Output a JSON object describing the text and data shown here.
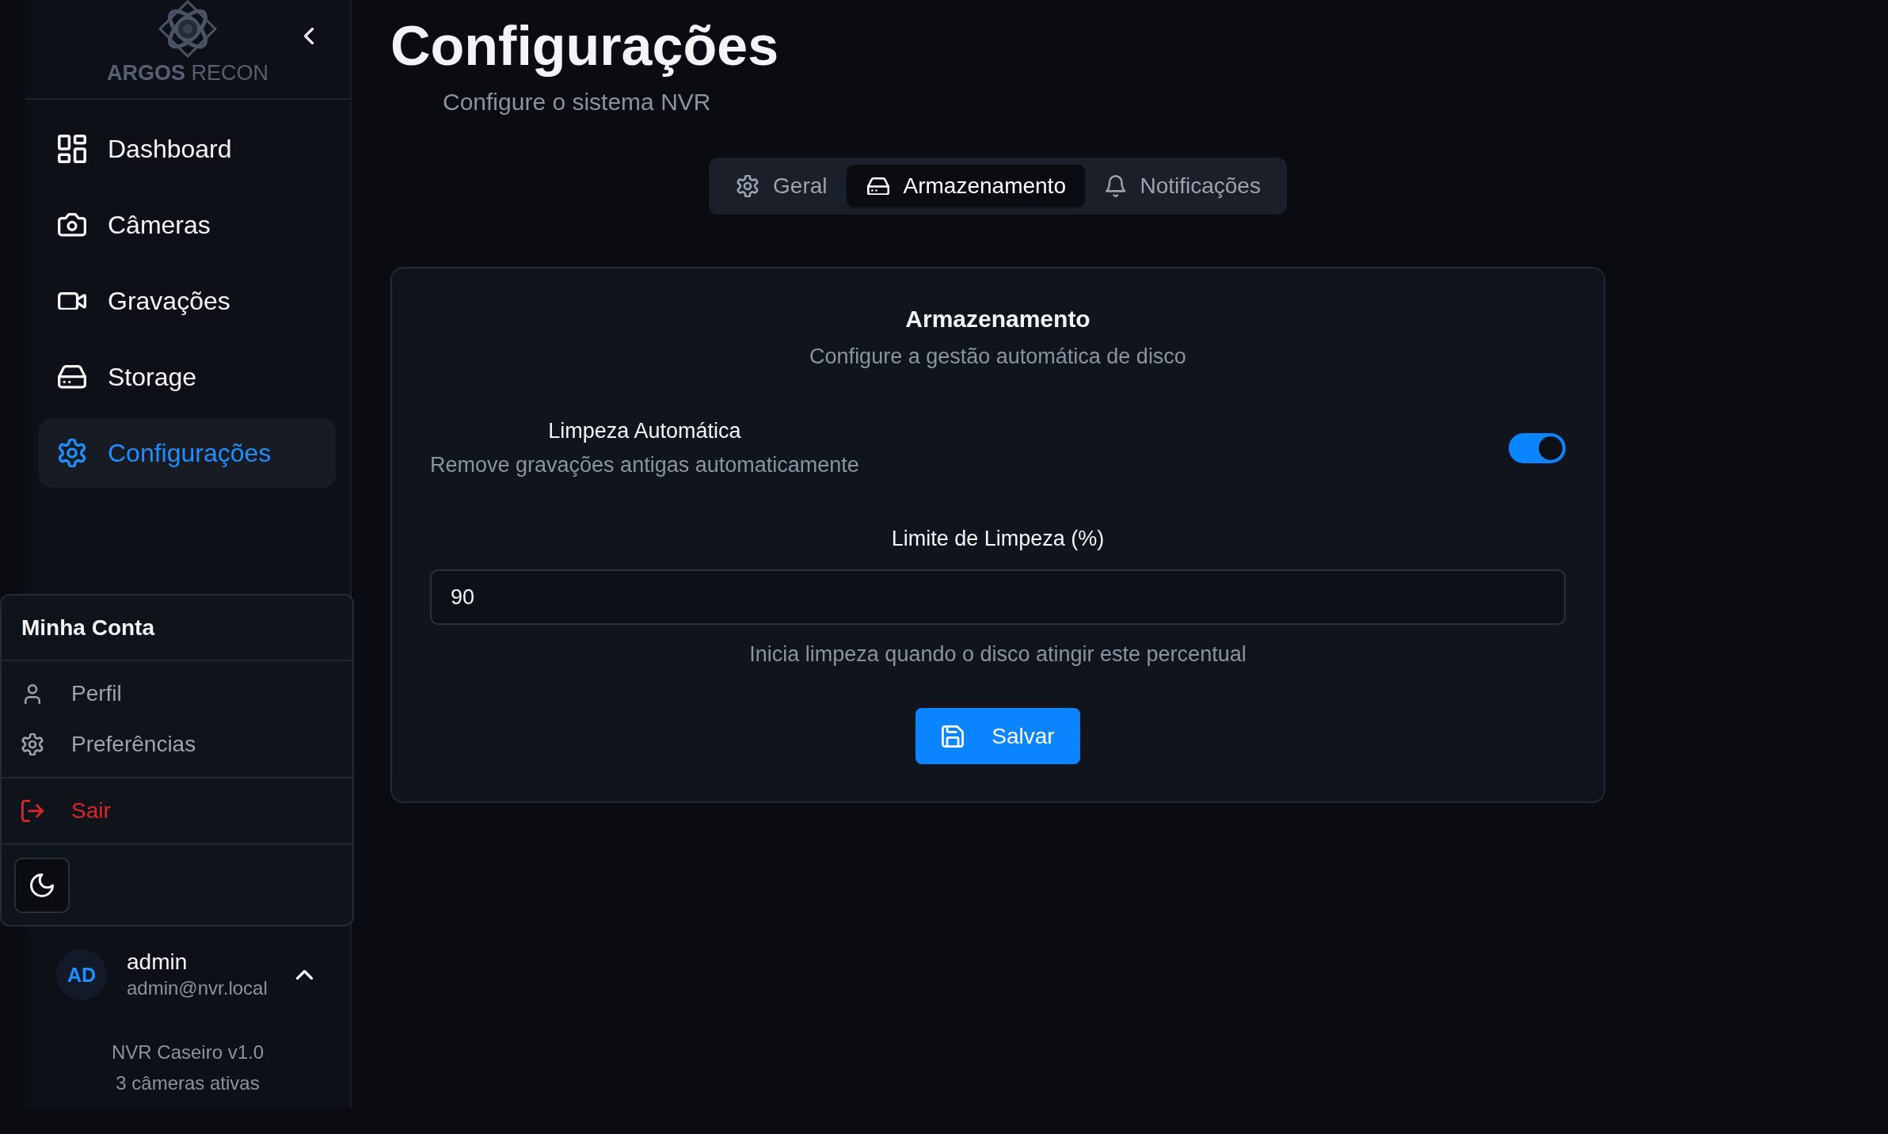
{
  "sidebar": {
    "logo_text": "**ARGOS** RECON",
    "nav_items": [
      {
        "label": "Dashboard",
        "kind": "dashboard",
        "selected": false
      },
      {
        "label": "Câmeras",
        "kind": "cameras",
        "selected": false
      },
      {
        "label": "Gravações",
        "kind": "recordings",
        "selected": false
      },
      {
        "label": "Storage",
        "kind": "storage",
        "selected": false
      },
      {
        "label": "Configurações",
        "kind": "settings",
        "selected": true
      }
    ],
    "user": {
      "initials": "AD",
      "name": "admin",
      "email": "admin@nvr.local",
      "expanded": true
    },
    "footer": {
      "version": "NVR Caseiro v1.0",
      "status": "3 câmeras ativas"
    }
  },
  "account_menu": {
    "title": "Minha Conta",
    "sections": [
      {
        "items": [
          {
            "label": "Perfil",
            "kind": "profile"
          },
          {
            "label": "Preferências",
            "kind": "preferences"
          }
        ]
      },
      {
        "items": [
          {
            "label": "Sair",
            "kind": "logout"
          }
        ]
      }
    ]
  },
  "page": {
    "title": "Configurações",
    "subtitle": "Configure o sistema NVR"
  },
  "tabs": [
    {
      "label": "Geral",
      "kind": "general",
      "selected": false
    },
    {
      "label": "Armazenamento",
      "kind": "storage",
      "selected": true
    },
    {
      "label": "Notificações",
      "kind": "notifications",
      "selected": false
    }
  ],
  "storage_card": {
    "title": "Armazenamento",
    "subtitle": "Configure a gestão automática de disco",
    "auto_cleanup": {
      "label": "Limpeza Automática",
      "description": "Remove gravações antigas automaticamente",
      "on": true
    },
    "cleanup_limit": {
      "label": "Limite de Limpeza (%)",
      "value": "90",
      "hint": "Inicia limpeza quando o disco atingir este percentual"
    },
    "save_button": {
      "label": "Salvar"
    }
  }
}
